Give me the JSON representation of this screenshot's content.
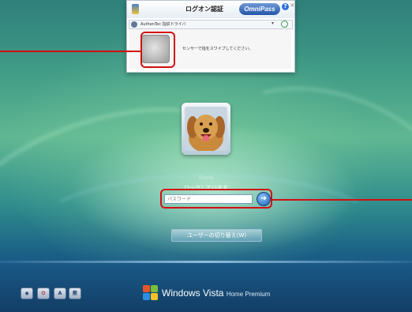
{
  "popup": {
    "title": "ログオン認証",
    "brand": "OmniPass",
    "help_icon": "?",
    "close_icon": "×",
    "device_label": "AuthenTec 指紋ドライバ",
    "dropdown_icon": "▾",
    "instruction": "センサーで指をスワイプしてください。"
  },
  "user": {
    "name": "Snow",
    "status": "ロックしています"
  },
  "password": {
    "placeholder": "パスワード",
    "go_icon": "➜"
  },
  "switch_user": "ユーザーの切り替え(W)",
  "bottom": {
    "ease_icon": "◉",
    "power_icon": "⏻",
    "lang_a": "A",
    "lang_kanji": "般",
    "brand_main": "Windows Vista",
    "brand_edition": "Home Premium"
  },
  "colors": {
    "annotation_red": "#d21010",
    "accent_blue": "#2456a8"
  }
}
